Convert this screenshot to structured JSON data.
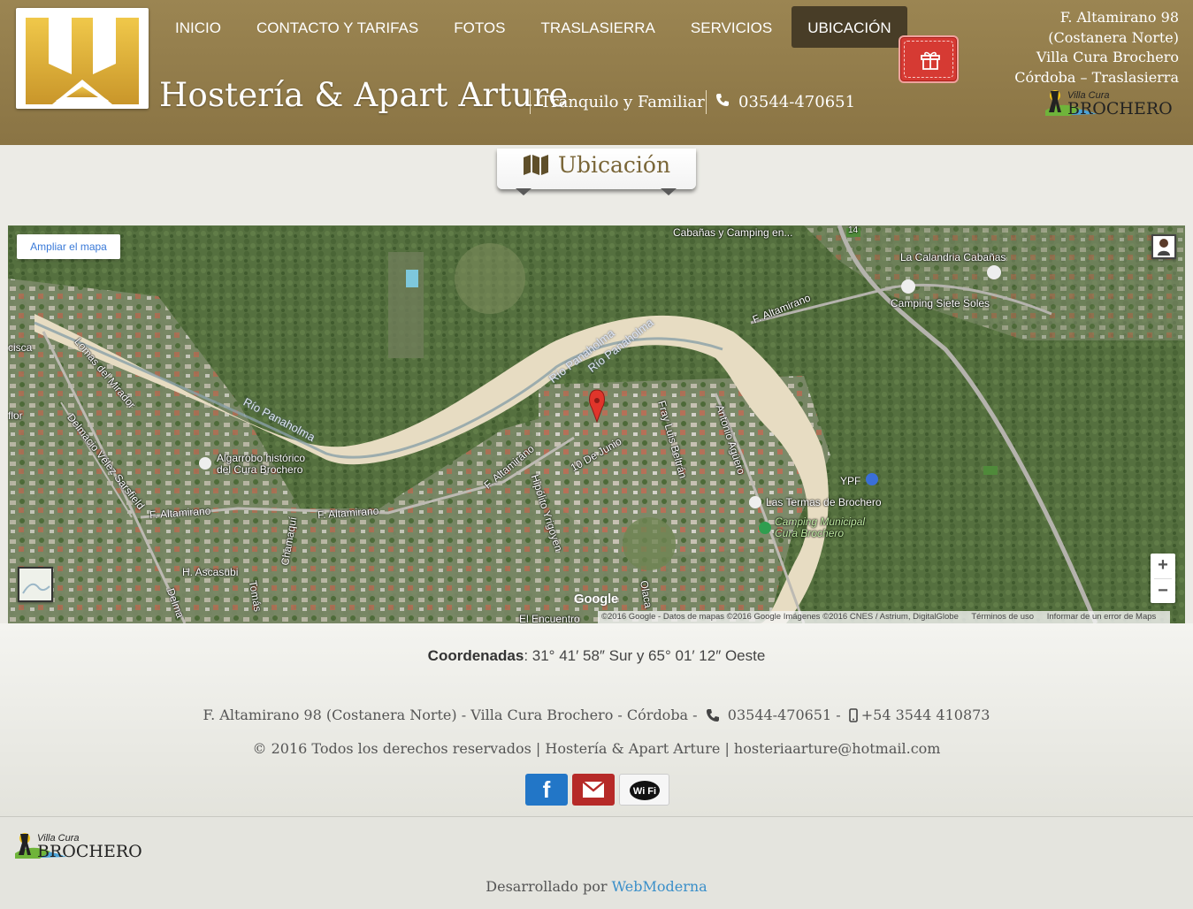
{
  "header": {
    "site_title": "Hostería & Apart Arture",
    "tagline": "Tranquilo y Familiar",
    "phone": "03544-470651",
    "nav": [
      "INICIO",
      "CONTACTO Y TARIFAS",
      "FOTOS",
      "TRASLASIERRA",
      "SERVICIOS",
      "UBICACIÓN"
    ],
    "nav_active": "UBICACIÓN",
    "address_lines": [
      "F. Altamirano 98",
      "(Costanera Norte)",
      "Villa Cura Brochero",
      "Córdoba – Traslasierra"
    ],
    "brochero_logo": {
      "small": "Villa Cura",
      "big": "BROCHERO"
    }
  },
  "section": {
    "title": "Ubicación",
    "icon": "map-icon"
  },
  "map": {
    "expand_label": "Ampliar el mapa",
    "zoom_in": "+",
    "zoom_out": "−",
    "google": "Google",
    "labels": {
      "cabanas": "Cabañas y Camping en...",
      "calandria": "La Calandria Cabañas",
      "siete_soles": "Camping Siete Soles",
      "altamirano_ne": "F. Altamirano",
      "rio_1": "Río Panaholma",
      "rio_2": "Río Panaholma",
      "rio_3": "Río Panaholma",
      "lomas": "Lomas del Mirador",
      "delmacio": "Delmacio Vélez Sarsfield",
      "algarrobo_1": "Algarrobo histórico",
      "algarrobo_2": "del Cura Brochero",
      "altamirano_w": "F. Altamirano",
      "altamirano_c": "F. Altamirano",
      "altamirano_d": "F. Altamirano",
      "junio": "10 De Junio",
      "fray": "Fray Luis Beltrán",
      "antonio": "Antonio Agüero",
      "hipolito": "Hipólito Yrigoyen",
      "chamaqui": "Chamaquí",
      "ascasubi": "H. Ascasubi",
      "tomas": "Tomás",
      "delma": "Delma",
      "encuentro": "El Encuentro",
      "ypf": "YPF",
      "termas": "Las Termas de Brochero",
      "camping_mun_1": "Camping Municipal",
      "camping_mun_2": "Cura Brochero",
      "cisca": "cisca",
      "flor": "flor",
      "olaca": "Olaca",
      "route": "14"
    },
    "attribution": [
      "©2016 Google - Datos de mapas ©2016 Google Imágenes ©2016 CNES / Astrium, DigitalGlobe",
      "Términos de uso",
      "Informar de un error de Maps"
    ]
  },
  "footer": {
    "coords_label": "Coordenadas",
    "coords_value": ": 31° 41′ 58″ Sur y 65° 01′ 12″ Oeste",
    "address": "F. Altamirano 98 (Costanera Norte) - Villa Cura Brochero - Córdoba -",
    "phone": "03544-470651 -",
    "mobile": "+54 3544 410873",
    "copyright": "© 2016 Todos los derechos reservados  |  Hostería & Apart Arture  |  hosteriaarture@hotmail.com",
    "social": [
      "facebook-icon",
      "mail-icon",
      "wifi-icon"
    ],
    "wifi_text": "Wi Fi",
    "brochero_logo": {
      "small": "Villa Cura",
      "big": "BROCHERO"
    },
    "dev_prefix": "Desarrollado por",
    "dev_link": "WebModerna"
  },
  "colors": {
    "header": "#8f7a48",
    "nav_active": "#483d27",
    "gift": "#d63a33",
    "title": "#7a6638",
    "link": "#3a8fc9"
  }
}
